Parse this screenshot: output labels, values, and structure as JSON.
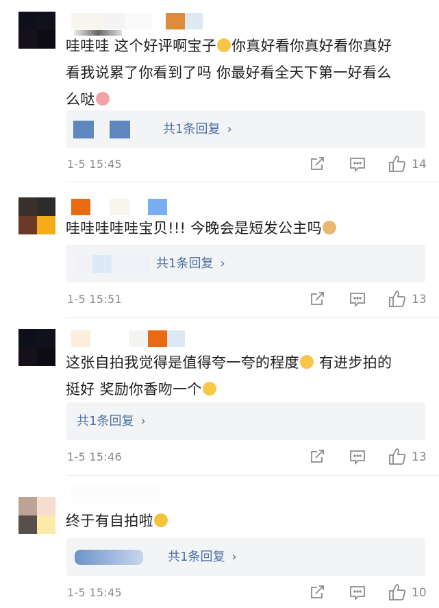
{
  "comments": [
    {
      "text": "哇哇哇 这个好评啊宝子🤗你真好看你真好看你真好看我说累了你看到了吗 你最好看全天下第一好看么么哒🐷",
      "line1": "哇哇哇 这个好评啊宝子",
      "line1b": "你真好看你真好看你真好",
      "line2": "看我说累了你看到了吗 你最好看全天下第一好看么",
      "line3": "么哒",
      "reply_label": "共1条回复",
      "time": "1-5 15:45",
      "likes": "14"
    },
    {
      "line1": "哇哇哇哇哇宝贝!!! 今晚会是短发公主吗",
      "reply_label": "共1条回复",
      "time": "1-5 15:51",
      "likes": "13"
    },
    {
      "line1": "这张自拍我觉得是值得夸一夸的程度",
      "line1b": " 有进步拍的",
      "line2": "挺好 奖励你香吻一个",
      "reply_label": "共1条回复",
      "time": "1-5 15:46",
      "likes": "13"
    },
    {
      "line1": "终于有自拍啦",
      "reply_label": "共1条回复",
      "time": "1-5 15:45",
      "likes": "10"
    }
  ],
  "icons": {
    "share": "share-icon",
    "comment": "comment-icon",
    "like": "thumbs-up-icon",
    "chevron": "chevron-right-icon"
  },
  "colors": {
    "link": "#4b6fa3",
    "meta": "#8a8a8a",
    "reply_bg": "#f3f4f6"
  }
}
